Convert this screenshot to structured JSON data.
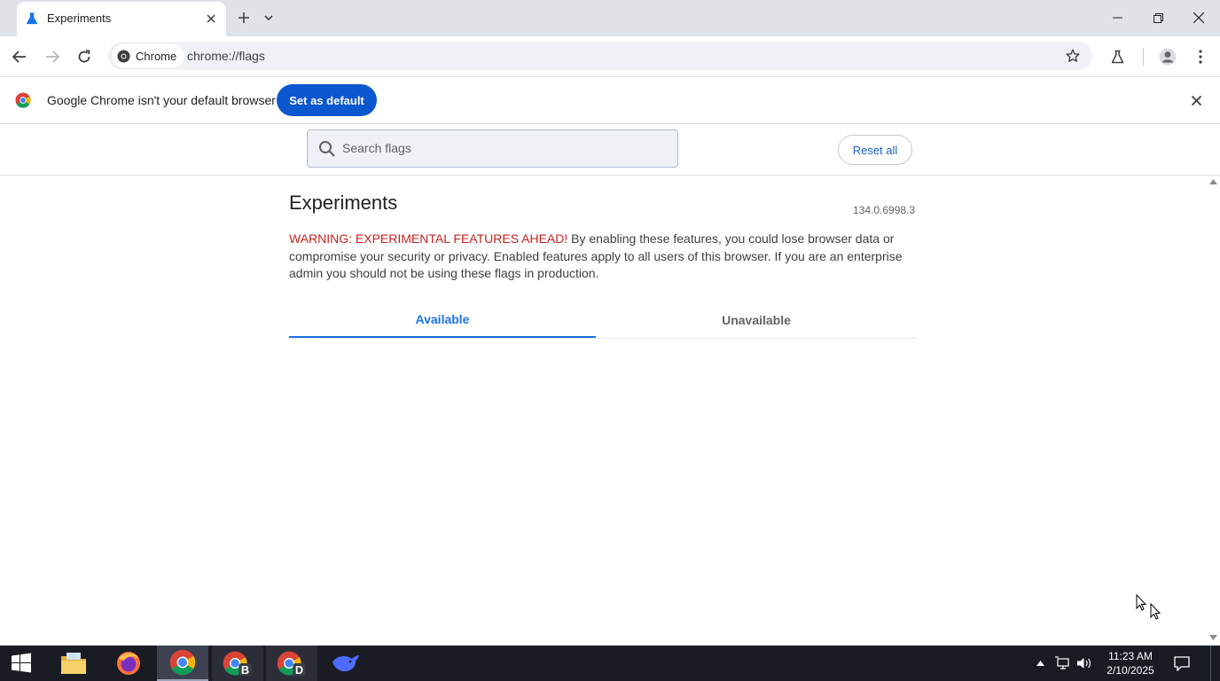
{
  "browser": {
    "tab": {
      "title": "Experiments"
    },
    "toolbar": {
      "chip_label": "Chrome",
      "url": "chrome://flags"
    },
    "infobar": {
      "message": "Google Chrome isn't your default browser",
      "button_label": "Set as default"
    }
  },
  "flags": {
    "search_placeholder": "Search flags",
    "reset_label": "Reset all",
    "title": "Experiments",
    "version": "134.0.6998.3",
    "warning_prefix": "WARNING: EXPERIMENTAL FEATURES AHEAD!",
    "warning_body": " By enabling these features, you could lose browser data or compromise your security or privacy. Enabled features apply to all users of this browser. If you are an enterprise admin you should not be using these flags in production.",
    "tabs": [
      {
        "label": "Available",
        "selected": true
      },
      {
        "label": "Unavailable",
        "selected": false
      }
    ]
  },
  "taskbar": {
    "apps": [
      "start-icon",
      "file-explorer-icon",
      "firefox-icon",
      "chrome-icon",
      "chrome-profile-b-icon",
      "chrome-profile-d-icon",
      "deepseek-icon"
    ],
    "active_app": "chrome-icon",
    "clock": {
      "time": "11:23 AM",
      "date": "2/10/2025"
    }
  },
  "colors": {
    "accent": "#0b57d0",
    "link_blue": "#1a73e8",
    "warning_red": "#c5221f",
    "tabstrip": "#dfe3e8",
    "taskbar": "#1a1c24"
  }
}
